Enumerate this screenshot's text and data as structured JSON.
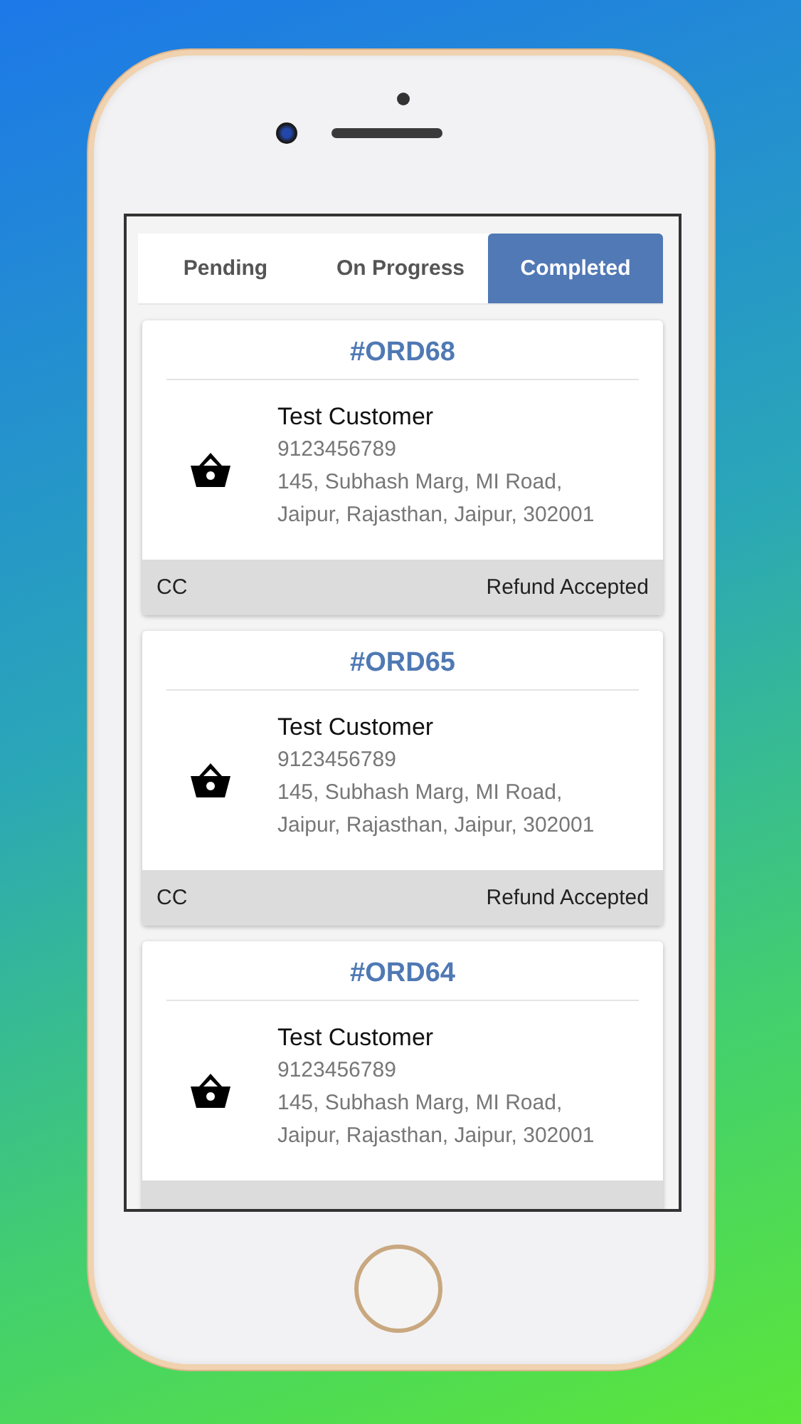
{
  "tabs": [
    {
      "label": "Pending",
      "selected": false
    },
    {
      "label": "On Progress",
      "selected": false
    },
    {
      "label": "Completed",
      "selected": true
    }
  ],
  "orders": [
    {
      "order_id": "#ORD68",
      "customer": "Test Customer",
      "phone": "9123456789",
      "address": "145, Subhash Marg, MI Road, Jaipur, Rajasthan, Jaipur, 302001",
      "payment": "CC",
      "status": "Refund Accepted"
    },
    {
      "order_id": "#ORD65",
      "customer": "Test Customer",
      "phone": "9123456789",
      "address": "145, Subhash Marg, MI Road, Jaipur, Rajasthan, Jaipur, 302001",
      "payment": "CC",
      "status": "Refund Accepted"
    },
    {
      "order_id": "#ORD64",
      "customer": "Test Customer",
      "phone": "9123456789",
      "address": "145, Subhash Marg, MI Road, Jaipur, Rajasthan, Jaipur, 302001"
    }
  ]
}
